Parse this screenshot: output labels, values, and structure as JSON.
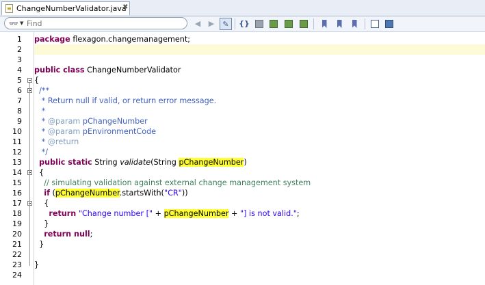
{
  "tab": {
    "title": "ChangeNumberValidator.java",
    "close": "✖"
  },
  "find": {
    "placeholder": "Find"
  },
  "code_lines": [
    [
      {
        "t": "package",
        "c": "kw"
      },
      {
        "t": " flexagon.changemanagement;"
      }
    ],
    [],
    [],
    [
      {
        "t": "public class",
        "c": "kw"
      },
      {
        "t": " ChangeNumberValidator"
      }
    ],
    [
      {
        "t": "{"
      }
    ],
    [
      {
        "t": "  "
      },
      {
        "t": "/**",
        "c": "cm"
      }
    ],
    [
      {
        "t": "   * Return null if valid, or return error message.",
        "c": "cm"
      }
    ],
    [
      {
        "t": "   *",
        "c": "cm"
      }
    ],
    [
      {
        "t": "   * ",
        "c": "cm"
      },
      {
        "t": "@param",
        "c": "tag"
      },
      {
        "t": " pChangeNumber",
        "c": "cm"
      }
    ],
    [
      {
        "t": "   * ",
        "c": "cm"
      },
      {
        "t": "@param",
        "c": "tag"
      },
      {
        "t": " pEnvironmentCode",
        "c": "cm"
      }
    ],
    [
      {
        "t": "   * ",
        "c": "cm"
      },
      {
        "t": "@return",
        "c": "tag"
      }
    ],
    [
      {
        "t": "   */",
        "c": "cm"
      }
    ],
    [
      {
        "t": "  "
      },
      {
        "t": "public static",
        "c": "kw"
      },
      {
        "t": " String "
      },
      {
        "t": "validate",
        "c": "it"
      },
      {
        "t": "(String "
      },
      {
        "t": "pChangeNumber",
        "c": "hl"
      },
      {
        "t": ")"
      }
    ],
    [
      {
        "t": "  {"
      }
    ],
    [
      {
        "t": "    "
      },
      {
        "t": "// simulating validation against external change management system",
        "c": "cm2"
      }
    ],
    [
      {
        "t": "    "
      },
      {
        "t": "if",
        "c": "kw"
      },
      {
        "t": " ("
      },
      {
        "t": "pChangeNumber",
        "c": "hl"
      },
      {
        "t": ".startsWith("
      },
      {
        "t": "\"CR\"",
        "c": "st"
      },
      {
        "t": "))"
      }
    ],
    [
      {
        "t": "    {"
      }
    ],
    [
      {
        "t": "      "
      },
      {
        "t": "return",
        "c": "kw"
      },
      {
        "t": " "
      },
      {
        "t": "\"Change number [\"",
        "c": "st"
      },
      {
        "t": " + "
      },
      {
        "t": "pChangeNumber",
        "c": "hl"
      },
      {
        "t": " + "
      },
      {
        "t": "\"] is not valid.\"",
        "c": "st"
      },
      {
        "t": ";"
      }
    ],
    [
      {
        "t": "    }"
      }
    ],
    [
      {
        "t": "    "
      },
      {
        "t": "return null",
        "c": "kw"
      },
      {
        "t": ";"
      }
    ],
    [
      {
        "t": "  }"
      }
    ],
    [],
    [
      {
        "t": "}"
      }
    ],
    []
  ],
  "line_numbers": [
    "1",
    "2",
    "3",
    "4",
    "5",
    "6",
    "7",
    "8",
    "9",
    "10",
    "11",
    "12",
    "13",
    "14",
    "15",
    "16",
    "17",
    "18",
    "19",
    "20",
    "21",
    "22",
    "23",
    "24"
  ],
  "current_line": 2,
  "fold_markers": [
    5,
    6,
    14,
    17
  ],
  "colors": {
    "keyword": "#7f0055",
    "javadoc": "#3f5fbf",
    "comment": "#3f7f5f",
    "string": "#2a00ff",
    "highlight": "#ffff33",
    "current_line": "#fdfbd6"
  }
}
